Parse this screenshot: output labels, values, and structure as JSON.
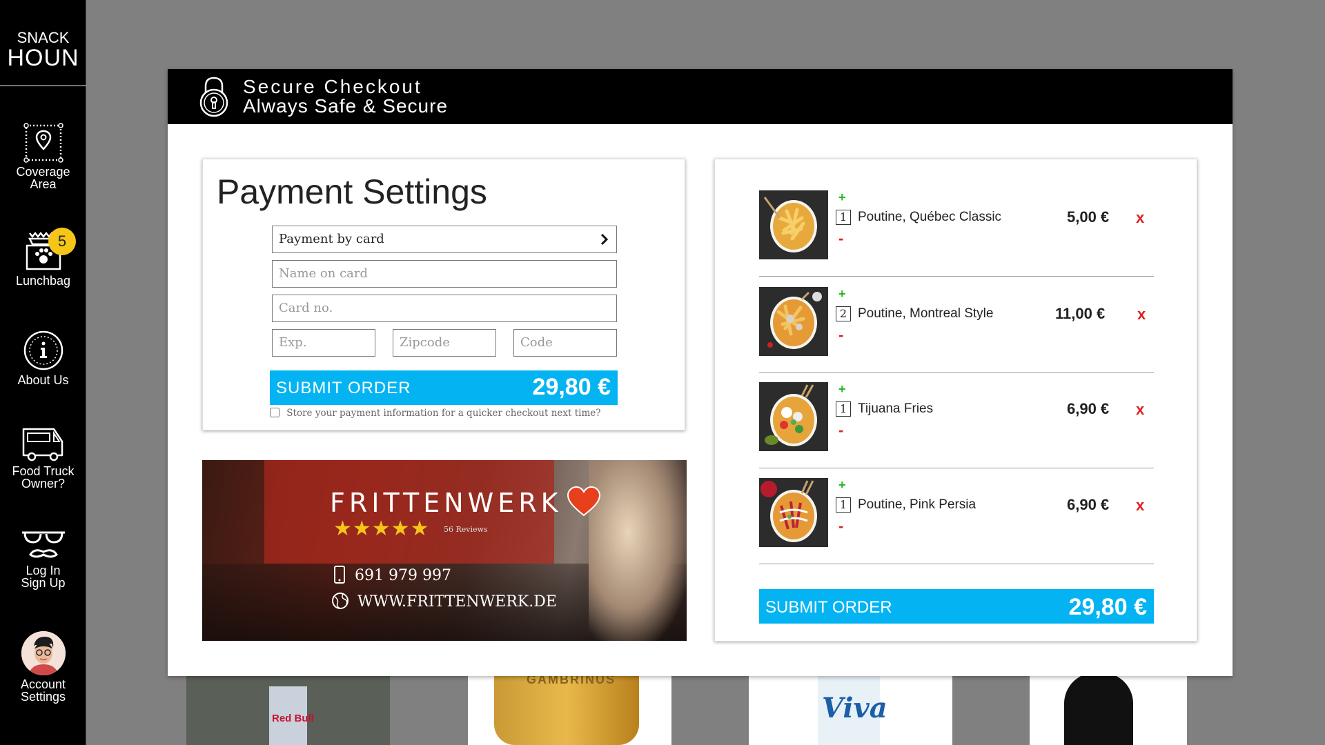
{
  "sidebar": {
    "logo_line1": "SNACK",
    "logo_line2": "HOUN",
    "items": [
      {
        "label": "Coverage\nArea",
        "icon": "map-pin-area-icon"
      },
      {
        "label": "Lunchbag",
        "icon": "lunchbag-paw-icon",
        "badge": "5"
      },
      {
        "label": "About Us",
        "icon": "info-icon"
      },
      {
        "label": "Food Truck\nOwner?",
        "icon": "food-truck-icon"
      },
      {
        "label": "Log In\nSign Up",
        "icon": "glasses-mustache-icon"
      },
      {
        "label": "Account\nSettings",
        "icon": "avatar"
      }
    ]
  },
  "checkout": {
    "title": "Secure Checkout",
    "subtitle": "Always Safe & Secure"
  },
  "payment": {
    "title": "Payment Settings",
    "method": "Payment by card",
    "name_placeholder": "Name on card",
    "card_placeholder": "Card no.",
    "exp_placeholder": "Exp.",
    "zip_placeholder": "Zipcode",
    "code_placeholder": "Code",
    "submit_label": "SUBMIT ORDER",
    "total": "29,80 €",
    "store_label": "Store your payment information for a quicker checkout next time?"
  },
  "banner": {
    "brand": "FRITTENWERK",
    "stars": "★★★★★",
    "reviews": "56 Reviews",
    "phone": "691 979 997",
    "website": "WWW.FRITTENWERK.DE"
  },
  "order": {
    "items": [
      {
        "qty": "1",
        "name": "Poutine, Québec Classic",
        "price": "5,00 €"
      },
      {
        "qty": "2",
        "name": "Poutine, Montreal Style",
        "price": "11,00 €"
      },
      {
        "qty": "1",
        "name": "Tijuana Fries",
        "price": "6,90 €"
      },
      {
        "qty": "1",
        "name": "Poutine, Pink Persia",
        "price": "6,90 €"
      }
    ],
    "plus": "+",
    "minus": "-",
    "remove": "x",
    "submit_label": "SUBMIT ORDER",
    "total": "29,80 €"
  },
  "background": {
    "product_texts": [
      "Red Bull",
      "GAMBRINUS",
      "Viva"
    ]
  },
  "colors": {
    "accent": "#04b4f2",
    "badge": "#f5c518",
    "add": "#1fba1f",
    "remove": "#e02020"
  }
}
